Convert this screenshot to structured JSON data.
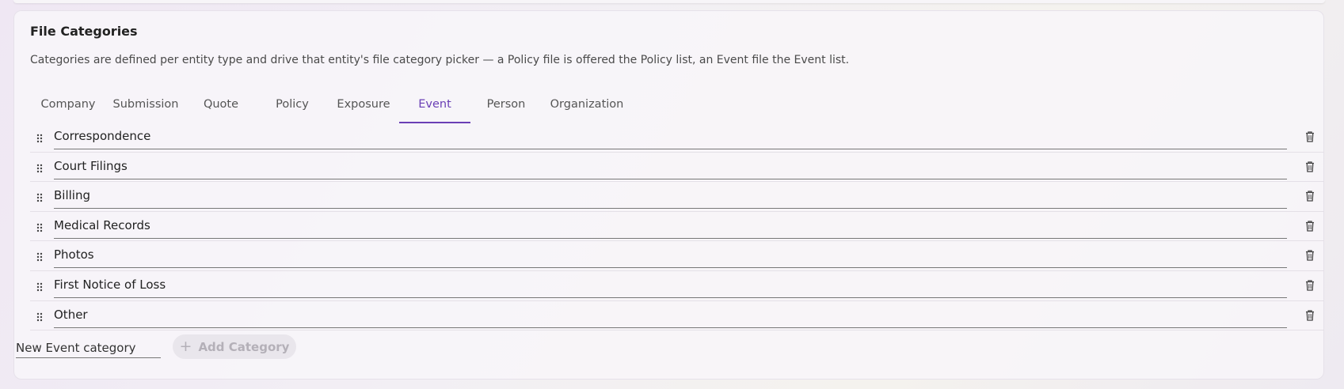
{
  "section": {
    "title": "File Categories",
    "description": "Categories are defined per entity type and drive that entity's file category picker — a Policy file is offered the Policy list, an Event file the Event list."
  },
  "tabs": [
    {
      "label": "Company",
      "active": false
    },
    {
      "label": "Submission",
      "active": false
    },
    {
      "label": "Quote",
      "active": false
    },
    {
      "label": "Policy",
      "active": false
    },
    {
      "label": "Exposure",
      "active": false
    },
    {
      "label": "Event",
      "active": true
    },
    {
      "label": "Person",
      "active": false
    },
    {
      "label": "Organization",
      "active": false
    }
  ],
  "categories": [
    "Correspondence",
    "Court Filings",
    "Billing",
    "Medical Records",
    "Photos",
    "First Notice of Loss",
    "Other"
  ],
  "new_category": {
    "placeholder": "New Event category",
    "value": "",
    "add_button_label": "Add Category",
    "add_button_enabled": false
  },
  "icons": {
    "drag": "drag-handle-icon",
    "delete": "trash-icon",
    "add": "plus-icon"
  },
  "colors": {
    "accent": "#6a3fb5",
    "disabled_text": "#b4b0b8",
    "disabled_bg": "#e9e6ec"
  }
}
